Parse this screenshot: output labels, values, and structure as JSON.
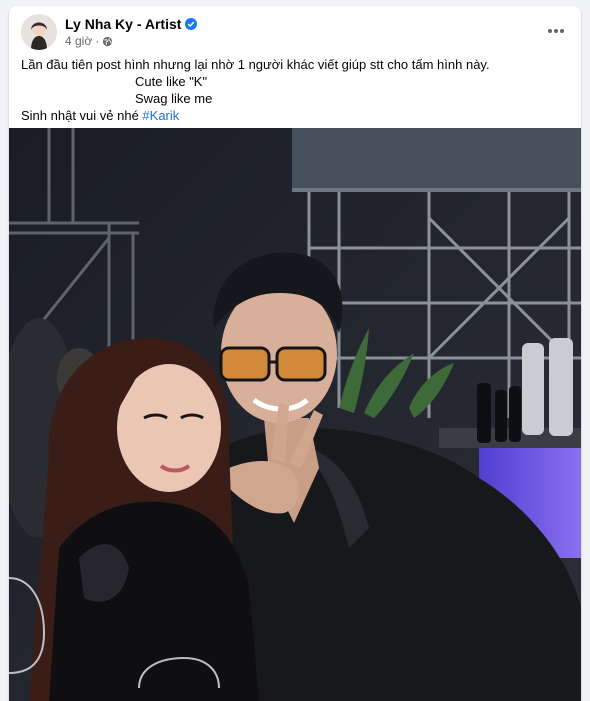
{
  "post": {
    "author": "Ly Nha Ky - Artist",
    "time": "4 giờ",
    "separator": "·",
    "privacy_icon": "globe-icon",
    "verified_icon": "verified-badge-icon",
    "more_icon": "more-options-icon",
    "lines": [
      "Lần đầu tiên post hình nhưng lại nhờ 1 người khác viết giúp stt cho tấm hình này.",
      "Cute like \"K\"",
      "Swag like me",
      "Sinh nhật vui vẻ nhé "
    ],
    "hashtag": "#Karik"
  },
  "colors": {
    "verified": "#1877f2",
    "hashtag": "#216fdb",
    "secondary_text": "#65676b"
  }
}
